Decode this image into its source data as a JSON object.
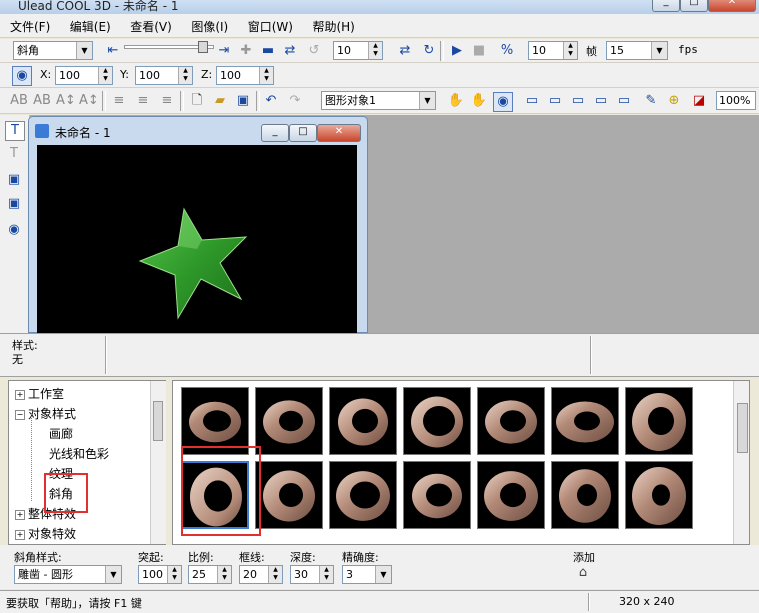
{
  "app": {
    "title": "Ulead COOL 3D - 未命名 - 1",
    "window_buttons": [
      "_",
      "□",
      "✕"
    ]
  },
  "menu": [
    "文件(F)",
    "编辑(E)",
    "查看(V)",
    "图像(I)",
    "窗口(W)",
    "帮助(H)"
  ],
  "toolbar1": {
    "effect_select": "斜角",
    "frame_value": "10",
    "fps_value_a": "10",
    "frame_label": "帧",
    "fps_value_b": "15",
    "fps_label": "fps"
  },
  "toolbar2": {
    "x_label": "X:",
    "x_value": "100",
    "y_label": "Y:",
    "y_value": "100",
    "z_label": "Z:",
    "z_value": "100"
  },
  "toolbar3": {
    "object_select": "图形对象1",
    "zoom": "100%"
  },
  "document": {
    "title": "未命名 - 1"
  },
  "style_panel": {
    "label": "样式:",
    "value": "无"
  },
  "tree": [
    {
      "label": "工作室",
      "expander": "+",
      "indent": 0
    },
    {
      "label": "对象样式",
      "expander": "−",
      "indent": 0
    },
    {
      "label": "画廊",
      "expander": "",
      "indent": 1
    },
    {
      "label": "光线和色彩",
      "expander": "",
      "indent": 1
    },
    {
      "label": "纹理",
      "expander": "",
      "indent": 1
    },
    {
      "label": "斜角",
      "expander": "",
      "indent": 1
    },
    {
      "label": "整体特效",
      "expander": "+",
      "indent": 0
    },
    {
      "label": "对象特效",
      "expander": "+",
      "indent": 0
    }
  ],
  "bevel": {
    "style_label": "斜角样式:",
    "style_value": "雕凿 - 圆形",
    "protrude_label": "突起:",
    "protrude_value": "100",
    "scale_label": "比例:",
    "scale_value": "25",
    "border_label": "框线:",
    "border_value": "20",
    "depth_label": "深度:",
    "depth_value": "30",
    "precision_label": "精确度:",
    "precision_value": "3",
    "add_label": "添加"
  },
  "status": {
    "help_text": "要获取「帮助」，请按 F1 键",
    "canvas_size": "320 x 240"
  },
  "colors": {
    "highlight_box": "#e03030",
    "star_green": "#2f9a2a"
  }
}
